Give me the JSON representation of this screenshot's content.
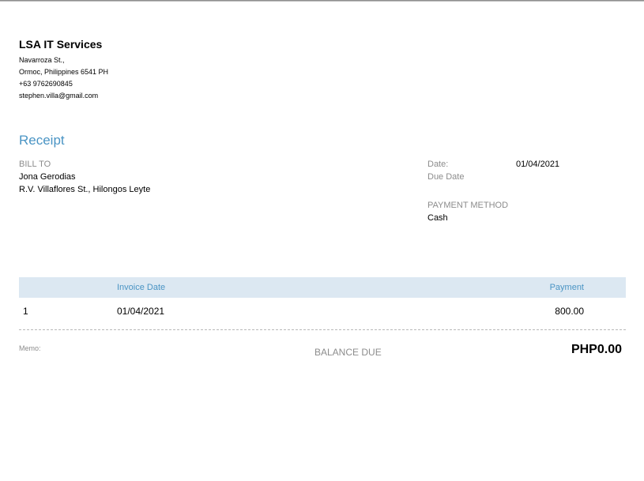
{
  "company": {
    "name": "LSA IT Services",
    "address_line1": "Navarroza St.,",
    "address_line2": "Ormoc, Philippines  6541 PH",
    "phone": "+63 9762690845",
    "email": "stephen.villa@gmail.com"
  },
  "document": {
    "title": "Receipt"
  },
  "bill_to": {
    "label": "BILL TO",
    "name": "Jona Gerodias",
    "address": "R.V. Villaflores St., Hilongos Leyte"
  },
  "meta": {
    "date_label": "Date:",
    "date_value": "01/04/2021",
    "due_date_label": "Due Date",
    "due_date_value": "",
    "payment_method_label": "PAYMENT METHOD",
    "payment_method_value": "Cash"
  },
  "table": {
    "headers": {
      "number": "",
      "invoice_date": "Invoice Date",
      "payment": "Payment"
    },
    "rows": [
      {
        "number": "1",
        "invoice_date": "01/04/2021",
        "payment": "800.00"
      }
    ]
  },
  "footer": {
    "memo_label": "Memo:",
    "balance_label": "BALANCE DUE",
    "balance_amount": "PHP0.00"
  }
}
